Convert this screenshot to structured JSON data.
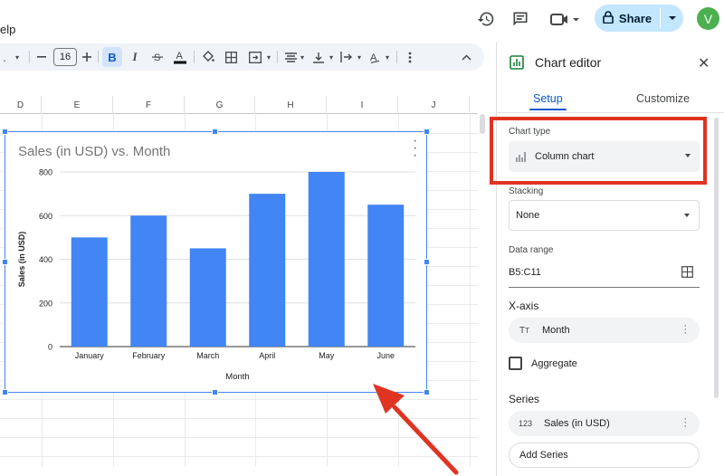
{
  "menu": {
    "help_partial": "elp"
  },
  "topbar": {
    "icons": [
      "history-icon",
      "comment-icon",
      "video-call-icon",
      "lock-icon"
    ],
    "share_label": "Share",
    "avatar_letter": "V"
  },
  "toolbar": {
    "font_partial": ".",
    "font_size": "16",
    "items": [
      "minus",
      "plus",
      "bold",
      "italic",
      "strikethrough",
      "text-color",
      "fill-color",
      "borders",
      "merge",
      "align",
      "valign",
      "wrap",
      "rotate",
      "more",
      "collapse"
    ]
  },
  "grid": {
    "columns": [
      "D",
      "E",
      "F",
      "G",
      "H",
      "I",
      "J"
    ]
  },
  "chart_data": {
    "type": "bar",
    "title": "Sales (in USD) vs. Month",
    "xlabel": "Month",
    "ylabel": "Sales (in USD)",
    "categories": [
      "January",
      "February",
      "March",
      "April",
      "May",
      "June"
    ],
    "values": [
      500,
      600,
      450,
      700,
      800,
      650
    ],
    "ylim": [
      0,
      800
    ],
    "yticks": [
      0,
      200,
      400,
      600,
      800
    ],
    "bar_color": "#4285f4",
    "grid": true
  },
  "panel": {
    "title": "Chart editor",
    "tabs": {
      "setup": "Setup",
      "customize": "Customize"
    },
    "chart_type_label": "Chart type",
    "chart_type_value": "Column chart",
    "stacking_label": "Stacking",
    "stacking_value": "None",
    "data_range_label": "Data range",
    "data_range_value": "B5:C11",
    "xaxis_heading": "X-axis",
    "xaxis_value": "Month",
    "aggregate_label": "Aggregate",
    "series_heading": "Series",
    "series_value": "Sales (in USD)",
    "add_series": "Add Series",
    "highlight_color": "#e03422"
  }
}
